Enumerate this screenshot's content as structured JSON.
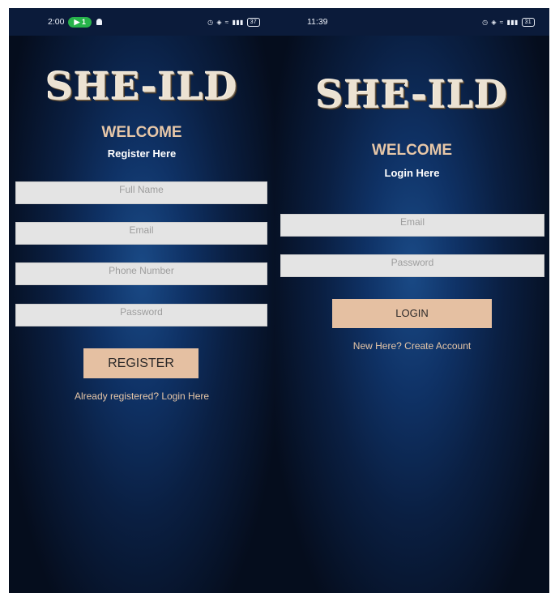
{
  "register_screen": {
    "status": {
      "time": "2:00",
      "notif_count": "1",
      "battery": "37"
    },
    "logo": "SHE-ILD",
    "welcome": "WELCOME",
    "subtitle": "Register Here",
    "fields": {
      "full_name_placeholder": "Full Name",
      "email_placeholder": "Email",
      "phone_placeholder": "Phone Number",
      "password_placeholder": "Password"
    },
    "register_button": "REGISTER",
    "login_link": "Already registered? Login Here"
  },
  "login_screen": {
    "status": {
      "time": "11:39",
      "battery": "31"
    },
    "logo": "SHE-ILD",
    "welcome": "WELCOME",
    "subtitle": "Login Here",
    "fields": {
      "email_placeholder": "Email",
      "password_placeholder": "Password"
    },
    "login_button": "LOGIN",
    "create_account_link": "New Here? Create Account"
  },
  "colors": {
    "background_center": "#1a4a86",
    "background_edge": "#050d1d",
    "accent_text": "#e7c7a8",
    "button_fill": "#e5c0a2",
    "field_fill": "#e4e4e4"
  }
}
